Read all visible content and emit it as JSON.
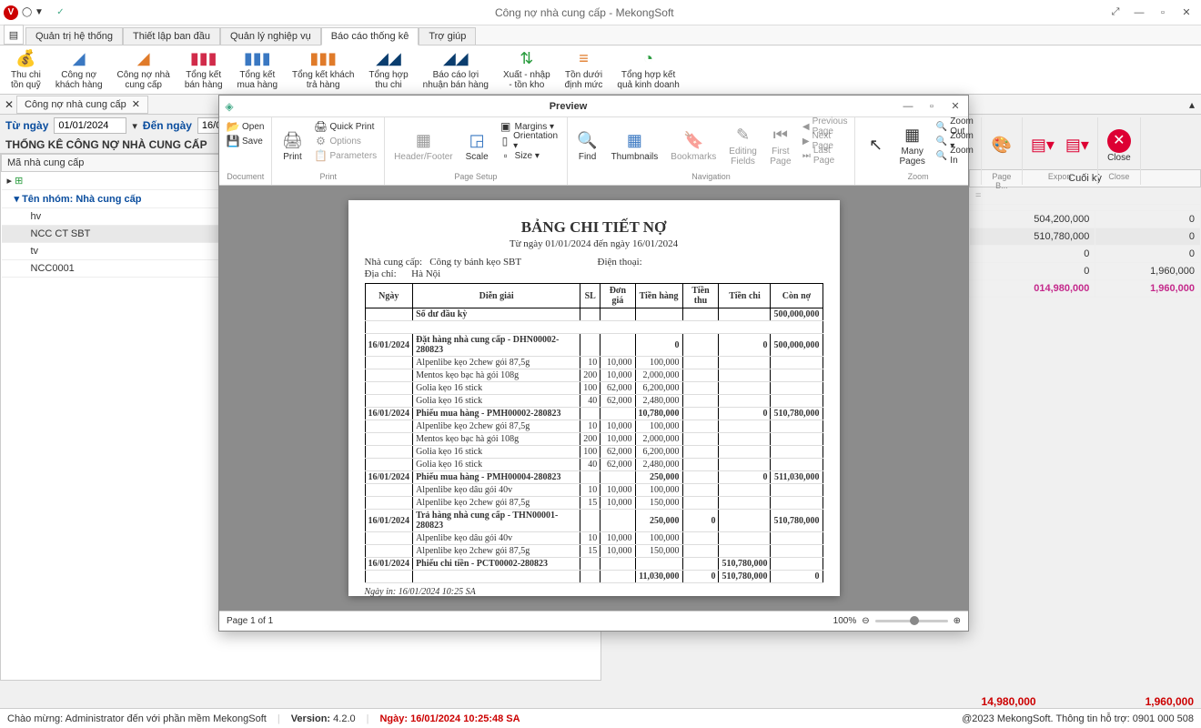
{
  "window": {
    "title": "Công nợ nhà cung cấp - MekongSoft",
    "app_letter": "V"
  },
  "menu_tabs": [
    "Quản trị hệ thống",
    "Thiết lập ban đầu",
    "Quản lý nghiệp vụ",
    "Báo cáo thống kê",
    "Trợ giúp"
  ],
  "ribbon": [
    {
      "icon": "💰",
      "color": "#2a9d3f",
      "label": "Thu chi\ntồn quỹ"
    },
    {
      "icon": "◢",
      "color": "#3a78c2",
      "label": "Công nợ\nkhách hàng"
    },
    {
      "icon": "◢",
      "color": "#e07b2a",
      "label": "Công nợ nhà\ncung cấp"
    },
    {
      "icon": "▮▮▮",
      "color": "#d12b4a",
      "label": "Tổng kết\nbán hàng"
    },
    {
      "icon": "▮▮▮",
      "color": "#3a78c2",
      "label": "Tổng kết\nmua hàng"
    },
    {
      "icon": "▮▮▮",
      "color": "#e07b2a",
      "label": "Tổng kết khách\ntrả hàng"
    },
    {
      "icon": "◢◢",
      "color": "#0a3d6e",
      "label": "Tổng hợp\nthu chi"
    },
    {
      "icon": "◢◢",
      "color": "#0a3d6e",
      "label": "Báo cáo lợi\nnhuận bán hàng"
    },
    {
      "icon": "⇅",
      "color": "#2a9d3f",
      "label": "Xuất - nhập\n- tồn kho"
    },
    {
      "icon": "≡",
      "color": "#e07b2a",
      "label": "Tồn dưới\nđịnh mức"
    },
    {
      "icon": "◔",
      "color": "#2a9d3f",
      "label": "Tổng hợp kết\nquả kinh doanh"
    }
  ],
  "doc_tab": "Công nợ nhà cung cấp",
  "filter": {
    "from_label": "Từ ngày",
    "from_value": "01/01/2024",
    "to_label": "Đến ngày",
    "to_value": "16/01/2024"
  },
  "report_title": "THỐNG KÊ CÔNG NỢ NHÀ CUNG CẤP",
  "left_grid": {
    "header": "Mã nhà cung cấp",
    "group": "Tên nhóm: Nhà cung cấp",
    "rows": [
      "hv",
      "NCC CT SBT",
      "tv",
      "NCC0001"
    ]
  },
  "right_grid": {
    "header": "Cuối kỳ",
    "placeholder": "=",
    "rows": [
      {
        "a": "504,200,000",
        "b": "0"
      },
      {
        "a": "510,780,000",
        "b": "0"
      },
      {
        "a": "0",
        "b": "0"
      },
      {
        "a": "0",
        "b": "1,960,000"
      }
    ],
    "total": {
      "a": "014,980,000",
      "b": "1,960,000"
    }
  },
  "footer_totals": {
    "a": "14,980,000",
    "b": "1,960,000"
  },
  "status_bar": {
    "welcome": "Chào mừng: Administrator đến với phần mềm MekongSoft",
    "version_label": "Version:",
    "version": "4.2.0",
    "date_label": "Ngày:",
    "date": "16/01/2024 10:25:48 SA",
    "right": "@2023 MekongSoft. Thông tin hỗ trợ: 0901 000 508"
  },
  "preview": {
    "title": "Preview",
    "ribbon_groups": {
      "document": {
        "label": "Document",
        "open": "Open",
        "save": "Save"
      },
      "print": {
        "label": "Print",
        "print": "Print",
        "quick": "Quick Print",
        "options": "Options",
        "params": "Parameters"
      },
      "page_setup": {
        "label": "Page Setup",
        "hf": "Header/Footer",
        "scale": "Scale",
        "margins": "Margins ▾",
        "orient": "Orientation ▾",
        "size": "Size ▾"
      },
      "nav": {
        "label": "Navigation",
        "find": "Find",
        "thumbs": "Thumbnails",
        "bm": "Bookmarks",
        "editing": "Editing\nFields",
        "first": "First\nPage",
        "prev": "Previous Page",
        "next": "Next Page",
        "last": "Last Page"
      },
      "zoom": {
        "label": "Zoom",
        "mouse": "▦",
        "many": "Many Pages",
        "out": "Zoom Out",
        "inbtn": "Zoom ▾",
        "zin": "Zoom In"
      },
      "pb": {
        "label": "Page B...",
        "icon": "🎨"
      },
      "export": {
        "label": "Export"
      },
      "close": {
        "label": "Close",
        "btn": "Close"
      }
    },
    "page_status": "Page 1 of 1",
    "zoom_pct": "100%",
    "page": {
      "title": "BẢNG CHI TIẾT NỢ",
      "subtitle": "Từ ngày 01/01/2024 đến ngày 16/01/2024",
      "supplier_label": "Nhà cung cấp:",
      "supplier": "Công ty bánh kẹo SBT",
      "address_label": "Địa chỉ:",
      "address": "Hà Nội",
      "phone_label": "Điện thoại:",
      "cols": [
        "Ngày",
        "Diễn giải",
        "SL",
        "Đơn giá",
        "Tiền hàng",
        "Tiền thu",
        "Tiền chi",
        "Còn nợ"
      ],
      "opening": {
        "label": "Số dư đầu kỳ",
        "val": "500,000,000"
      },
      "blocks": [
        {
          "date": "16/01/2024",
          "head": "Đặt hàng nhà cung cấp - DHN00002-280823",
          "hm": "0",
          "hc": "0",
          "hd": "500,000,000",
          "lines": [
            {
              "d": "Alpenlibe kẹo 2chew gói 87,5g",
              "sl": "10",
              "dg": "10,000",
              "th": "100,000"
            },
            {
              "d": "Mentos kẹo bạc hà gói 108g",
              "sl": "200",
              "dg": "10,000",
              "th": "2,000,000"
            },
            {
              "d": "Golia kẹo 16 stick",
              "sl": "100",
              "dg": "62,000",
              "th": "6,200,000"
            },
            {
              "d": "Golia kẹo 16 stick",
              "sl": "40",
              "dg": "62,000",
              "th": "2,480,000"
            }
          ]
        },
        {
          "date": "16/01/2024",
          "head": "Phiếu mua hàng - PMH00002-280823",
          "hm": "10,780,000",
          "hc": "0",
          "hd": "510,780,000",
          "lines": [
            {
              "d": "Alpenlibe kẹo 2chew gói 87,5g",
              "sl": "10",
              "dg": "10,000",
              "th": "100,000"
            },
            {
              "d": "Mentos kẹo bạc hà gói 108g",
              "sl": "200",
              "dg": "10,000",
              "th": "2,000,000"
            },
            {
              "d": "Golia kẹo 16 stick",
              "sl": "100",
              "dg": "62,000",
              "th": "6,200,000"
            },
            {
              "d": "Golia kẹo 16 stick",
              "sl": "40",
              "dg": "62,000",
              "th": "2,480,000"
            }
          ]
        },
        {
          "date": "16/01/2024",
          "head": "Phiếu mua hàng - PMH00004-280823",
          "hm": "250,000",
          "hc": "0",
          "hd": "511,030,000",
          "lines": [
            {
              "d": "Alpenlibe kẹo dâu gói 40v",
              "sl": "10",
              "dg": "10,000",
              "th": "100,000"
            },
            {
              "d": "Alpenlibe kẹo 2chew gói 87,5g",
              "sl": "15",
              "dg": "10,000",
              "th": "150,000"
            }
          ]
        },
        {
          "date": "16/01/2024",
          "head": "Trả hàng nhà cung cấp - THN00001-280823",
          "hm": "250,000",
          "ht": "0",
          "hd": "510,780,000",
          "lines": [
            {
              "d": "Alpenlibe kẹo dâu gói 40v",
              "sl": "10",
              "dg": "10,000",
              "th": "100,000"
            },
            {
              "d": "Alpenlibe kẹo 2chew gói 87,5g",
              "sl": "15",
              "dg": "10,000",
              "th": "150,000"
            }
          ]
        },
        {
          "date": "16/01/2024",
          "head": "Phiếu chi tiền - PCT00002-280823",
          "hc": "510,780,000",
          "hd": "",
          "lines": []
        }
      ],
      "sum": {
        "m": "11,030,000",
        "t": "0",
        "c": "510,780,000",
        "d": "0"
      },
      "print_date": "Ngày in: 16/01/2024 10:25 SA"
    }
  }
}
